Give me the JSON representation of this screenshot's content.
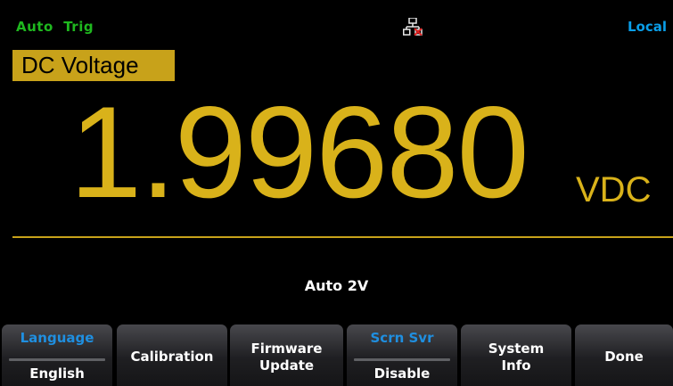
{
  "status_bar": {
    "trigger": "Auto  Trig",
    "remote": "Local",
    "lan_icon": "lan-disconnected-icon"
  },
  "measurement": {
    "function": "DC Voltage",
    "value": "1.99680",
    "unit": "VDC",
    "range": "Auto  2V"
  },
  "softkeys": {
    "language": {
      "title": "Language",
      "value": "English"
    },
    "calibration": {
      "label": "Calibration"
    },
    "firmware": {
      "line1": "Firmware",
      "line2": "Update"
    },
    "screen_saver": {
      "title": "Scrn  Svr",
      "value": "Disable"
    },
    "system_info": {
      "line1": "System",
      "line2": "Info"
    },
    "done": {
      "label": "Done"
    }
  },
  "colors": {
    "background": "#000000",
    "reading": "#d9b21a",
    "function_bg": "#c8a21a",
    "trigger_text": "#1fb81f",
    "remote_text": "#0a9ee8",
    "softkey_title": "#1f8fe0",
    "lan_icon_error": "#e02020"
  }
}
